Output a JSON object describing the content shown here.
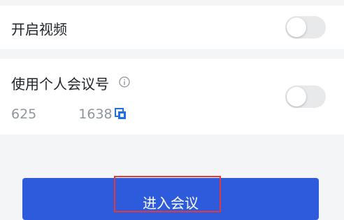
{
  "settings": {
    "video": {
      "label": "开启视频",
      "enabled": false
    },
    "personal_meeting_id": {
      "label": "使用个人会议号",
      "id_prefix": "625",
      "id_suffix": "1638",
      "enabled": false
    }
  },
  "actions": {
    "join_label": "进入会议"
  },
  "colors": {
    "accent": "#2e5bdb",
    "copy_icon": "#1f6fe5",
    "highlight": "#e0393e",
    "toggle_off": "#e8e9eb"
  },
  "icons": {
    "info": "info-icon",
    "copy": "copy-icon"
  }
}
